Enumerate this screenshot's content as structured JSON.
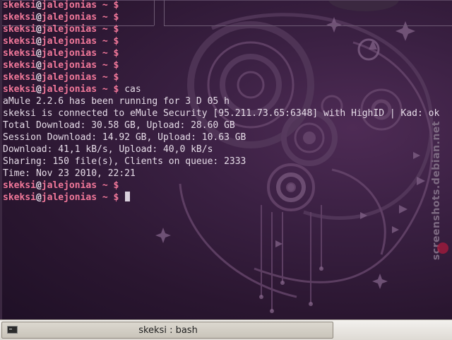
{
  "terminal": {
    "lines": [
      {
        "type": "prompt",
        "user": "skeksi",
        "at": "@",
        "host": "jalejonias",
        "tail": " ~ $",
        "cmd": ""
      },
      {
        "type": "prompt",
        "user": "skeksi",
        "at": "@",
        "host": "jalejonias",
        "tail": " ~ $",
        "cmd": ""
      },
      {
        "type": "prompt",
        "user": "skeksi",
        "at": "@",
        "host": "jalejonias",
        "tail": " ~ $",
        "cmd": ""
      },
      {
        "type": "prompt",
        "user": "skeksi",
        "at": "@",
        "host": "jalejonias",
        "tail": " ~ $",
        "cmd": ""
      },
      {
        "type": "prompt",
        "user": "skeksi",
        "at": "@",
        "host": "jalejonias",
        "tail": " ~ $",
        "cmd": ""
      },
      {
        "type": "prompt",
        "user": "skeksi",
        "at": "@",
        "host": "jalejonias",
        "tail": " ~ $",
        "cmd": ""
      },
      {
        "type": "prompt",
        "user": "skeksi",
        "at": "@",
        "host": "jalejonias",
        "tail": " ~ $",
        "cmd": ""
      },
      {
        "type": "prompt",
        "user": "skeksi",
        "at": "@",
        "host": "jalejonias",
        "tail": " ~ $",
        "cmd": " cas"
      },
      {
        "type": "output",
        "text": "aMule 2.2.6 has been running for 3 D 05 h"
      },
      {
        "type": "output",
        "text": "skeksi is connected to eMule Security [95.211.73.65:6348] with HighID | Kad: ok"
      },
      {
        "type": "output",
        "text": "Total Download: 30.58 GB, Upload: 28.60 GB"
      },
      {
        "type": "output",
        "text": "Session Download: 14.92 GB, Upload: 10.63 GB"
      },
      {
        "type": "output",
        "text": "Download: 41,1 kB/s, Upload: 40,0 kB/s"
      },
      {
        "type": "output",
        "text": "Sharing: 150 file(s), Clients on queue: 2333"
      },
      {
        "type": "output",
        "text": "Time: Nov 23 2010, 22:21"
      },
      {
        "type": "prompt",
        "user": "skeksi",
        "at": "@",
        "host": "jalejonias",
        "tail": " ~ $",
        "cmd": ""
      },
      {
        "type": "prompt",
        "user": "skeksi",
        "at": "@",
        "host": "jalejonias",
        "tail": " ~ $",
        "cmd": " ",
        "cursor": true
      }
    ]
  },
  "watermark": "screenshots.debian.net",
  "taskbar": {
    "window_title": "skeksi : bash",
    "icon": "terminal-icon"
  },
  "colors": {
    "prompt": "#f2789a",
    "text": "#e6dce8",
    "background": "#2a1733"
  }
}
